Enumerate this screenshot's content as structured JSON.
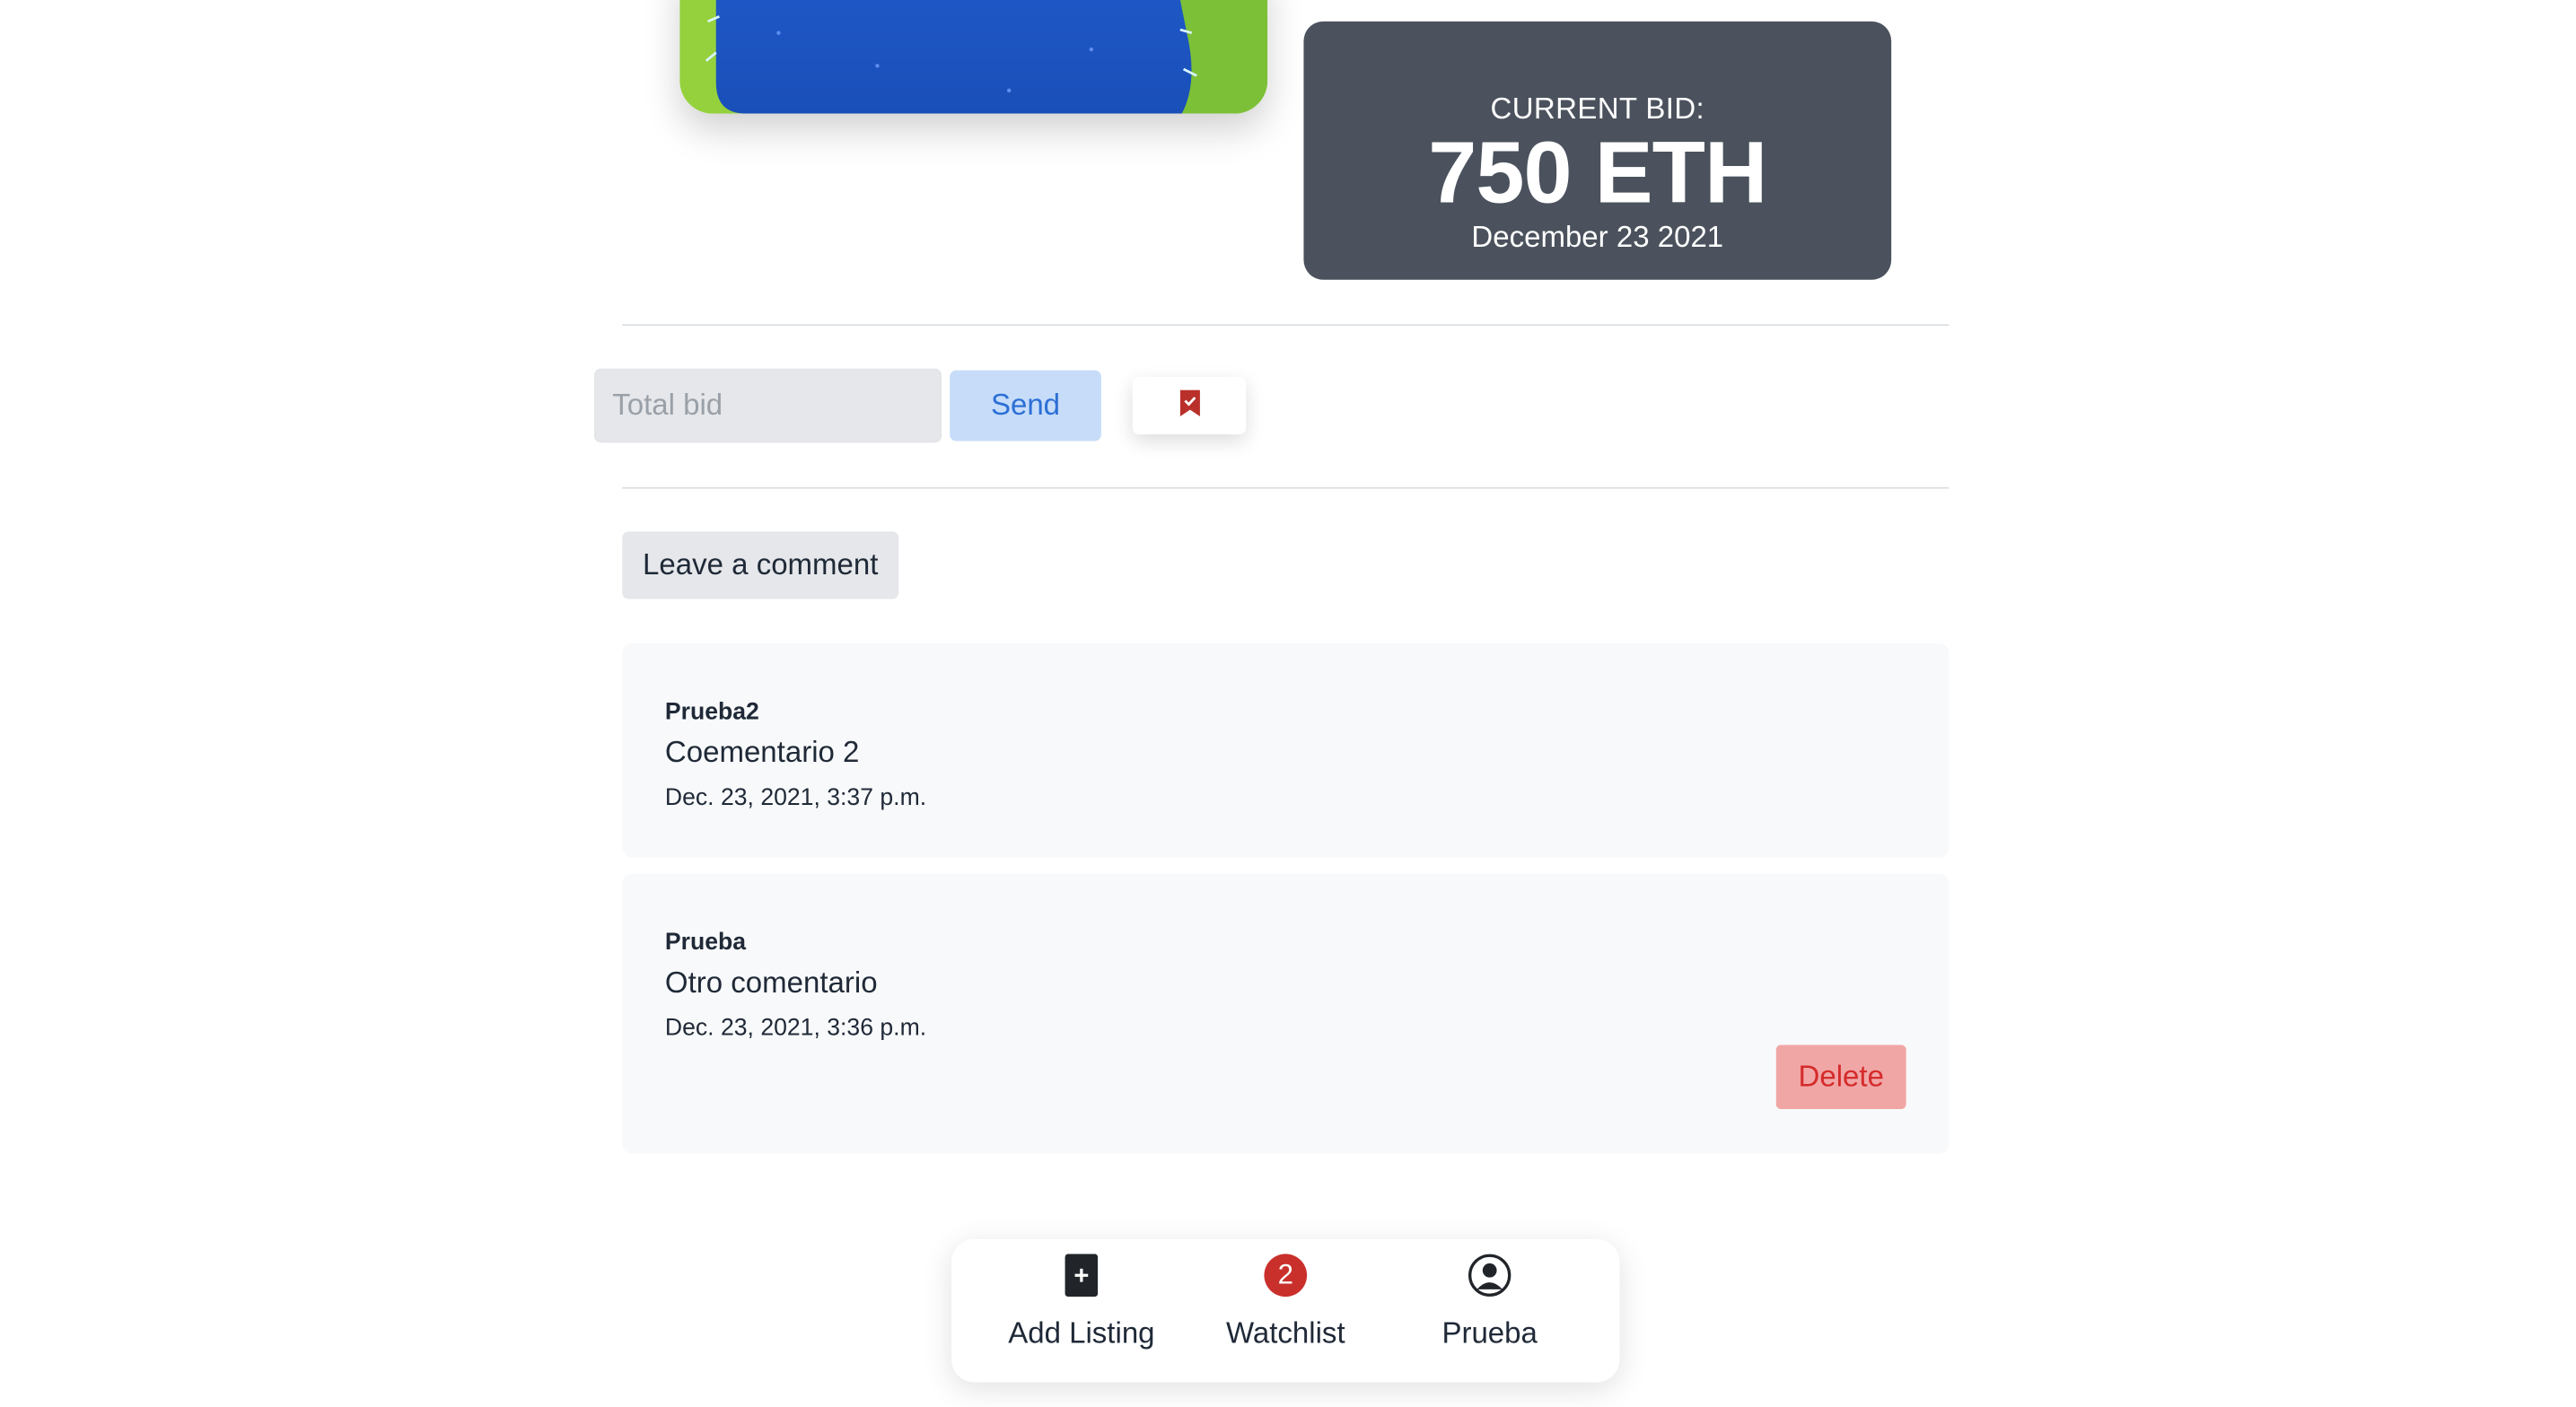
{
  "bid": {
    "label": "CURRENT BID:",
    "amount": "750 ETH",
    "date": "December 23 2021"
  },
  "bid_form": {
    "placeholder": "Total bid",
    "send_label": "Send",
    "watchlist_icon": "bookmark-check-icon"
  },
  "comments": {
    "leave_label": "Leave a comment",
    "items": [
      {
        "author": "Prueba2",
        "text": "Coementario 2",
        "time": "Dec. 23, 2021, 3:37 p.m."
      },
      {
        "author": "Prueba",
        "text": "Otro comentario",
        "time": "Dec. 23, 2021, 3:36 p.m.",
        "delete_label": "Delete"
      }
    ]
  },
  "nav": {
    "add_listing": {
      "label": "Add Listing",
      "icon": "add-file-icon"
    },
    "watchlist": {
      "label": "Watchlist",
      "count": "2"
    },
    "profile": {
      "label": "Prueba",
      "icon": "user-circle-icon"
    }
  },
  "colors": {
    "bid_card": "#4b525d",
    "send_button_bg": "#c6dcf9",
    "send_button_text": "#2c6fd6",
    "delete_button_bg": "#f1a6a6",
    "delete_button_text": "#d52b2b",
    "badge": "#c9302c",
    "bookmark_icon": "#b9302a"
  }
}
